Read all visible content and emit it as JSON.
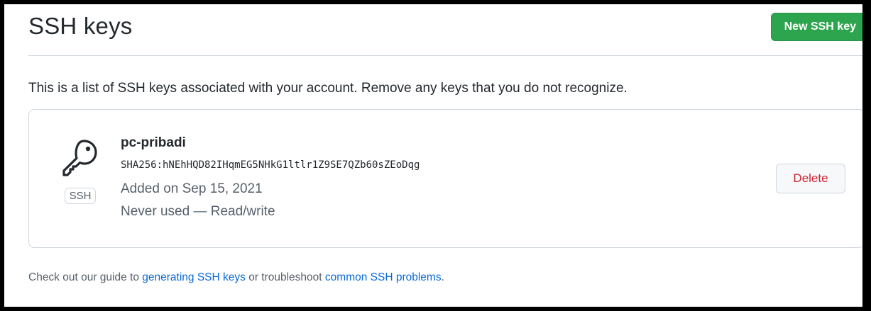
{
  "header": {
    "title": "SSH keys",
    "new_key_button": "New SSH key"
  },
  "description": "This is a list of SSH keys associated with your account. Remove any keys that you do not recognize.",
  "keys": [
    {
      "icon": "key-icon",
      "type_label": "SSH",
      "title": "pc-pribadi",
      "fingerprint": "SHA256:hNEhHQD82IHqmEG5NHkG1ltlr1Z9SE7QZb60sZEoDqg",
      "added": "Added on Sep 15, 2021",
      "usage": "Never used — Read/write",
      "delete_label": "Delete"
    }
  ],
  "footer": {
    "prefix": "Check out our guide to ",
    "link1": "generating SSH keys",
    "middle": " or troubleshoot ",
    "link2": "common SSH problems",
    "suffix": "."
  },
  "colors": {
    "primary_button": "#2da44e",
    "danger_text": "#cf222e",
    "link": "#0969da"
  }
}
